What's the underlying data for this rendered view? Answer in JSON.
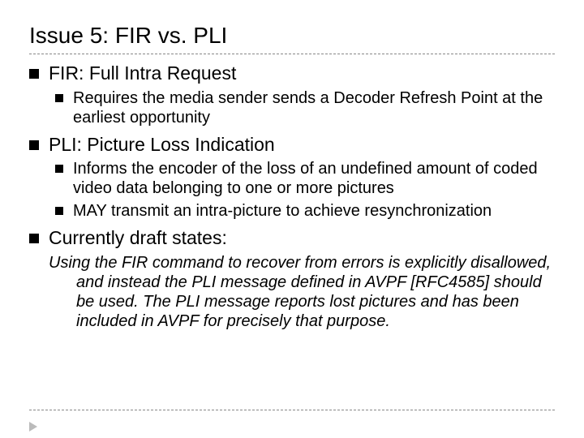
{
  "title": "Issue 5: FIR vs. PLI",
  "items": [
    {
      "label": "FIR:  Full Intra Request",
      "subs": [
        "Requires the media sender sends a Decoder Refresh Point at the earliest opportunity"
      ]
    },
    {
      "label": "PLI:  Picture Loss Indication",
      "subs": [
        "Informs the encoder of the loss of an undefined amount of coded video data belonging to one or more pictures",
        "MAY transmit an intra-picture to achieve resynchronization"
      ]
    },
    {
      "label": "Currently draft states:",
      "subs": []
    }
  ],
  "quote": "Using the FIR command to recover from errors is explicitly disallowed, and instead the PLI message defined in AVPF [RFC4585] should be used.  The PLI message reports lost pictures and has been included in AVPF for precisely that purpose."
}
